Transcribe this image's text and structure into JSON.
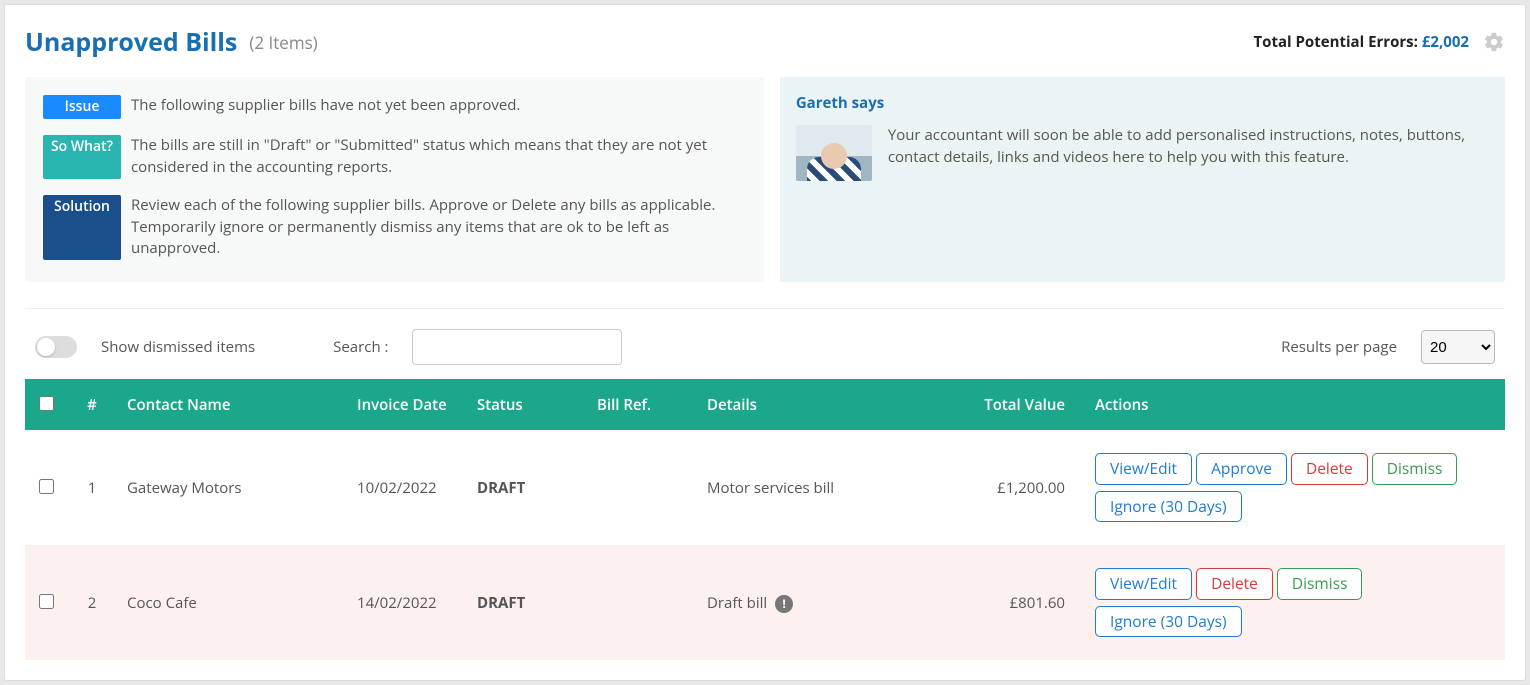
{
  "header": {
    "title": "Unapproved Bills",
    "count_label": "(2 Items)",
    "total_label": "Total Potential Errors: ",
    "total_amount": "£2,002"
  },
  "info": {
    "issue_tag": "Issue",
    "issue_text": "The following supplier bills have not yet been approved.",
    "sowhat_tag": "So What?",
    "sowhat_text": "The bills are still in \"Draft\" or \"Submitted\" status which means that they are not yet considered in the accounting reports.",
    "solution_tag": "Solution",
    "solution_text": "Review each of the following supplier bills. Approve or Delete any bills as applicable. Temporarily ignore or permanently dismiss any items that are ok to be left as unapproved."
  },
  "gareth": {
    "title": "Gareth says",
    "text": "Your accountant will soon be able to add personalised instructions, notes, buttons, contact details, links and videos here to help you with this feature."
  },
  "controls": {
    "show_dismissed": "Show dismissed items",
    "search_label": "Search :",
    "rpp_label": "Results per page",
    "rpp_value": "20"
  },
  "columns": {
    "num": "#",
    "contact": "Contact Name",
    "date": "Invoice Date",
    "status": "Status",
    "ref": "Bill Ref.",
    "details": "Details",
    "total": "Total Value",
    "actions": "Actions"
  },
  "buttons": {
    "view": "View/Edit",
    "approve": "Approve",
    "delete": "Delete",
    "dismiss": "Dismiss",
    "ignore": "Ignore (30 Days)"
  },
  "rows": [
    {
      "num": "1",
      "contact": "Gateway Motors",
      "date": "10/02/2022",
      "status": "DRAFT",
      "ref": "",
      "details": "Motor services bill",
      "warn": false,
      "total": "£1,200.00",
      "approve": true
    },
    {
      "num": "2",
      "contact": "Coco Cafe",
      "date": "14/02/2022",
      "status": "DRAFT",
      "ref": "",
      "details": "Draft bill",
      "warn": true,
      "total": "£801.60",
      "approve": false
    }
  ]
}
